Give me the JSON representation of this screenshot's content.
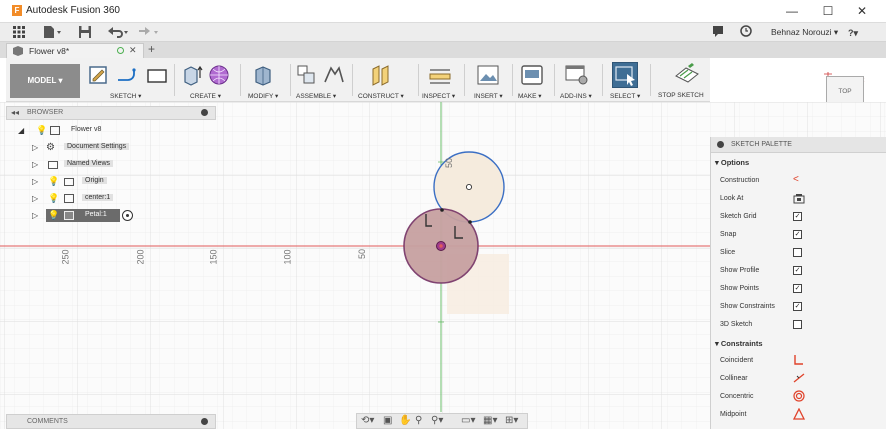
{
  "window": {
    "title": "Autodesk Fusion 360",
    "minimize": "—",
    "maximize": "☐",
    "close": "✕"
  },
  "quickbar": {
    "user_name": "Behnaz Norouzi ▾",
    "help": "?▾"
  },
  "tab": {
    "label": "Flower v8*",
    "close": "✕",
    "add": "+"
  },
  "toolbar": {
    "model_label": "MODEL ▾",
    "groups": {
      "sketch": "SKETCH ▾",
      "create": "CREATE ▾",
      "modify": "MODIFY ▾",
      "assemble": "ASSEMBLE ▾",
      "construct": "CONSTRUCT ▾",
      "inspect": "INSPECT ▾",
      "insert": "INSERT ▾",
      "make": "MAKE ▾",
      "addins": "ADD-INS ▾",
      "select": "SELECT ▾",
      "stop_sketch": "STOP SKETCH"
    }
  },
  "browser": {
    "header": "BROWSER",
    "root": "Flower v8",
    "items": [
      {
        "label": "Document Settings"
      },
      {
        "label": "Named Views"
      },
      {
        "label": "Origin"
      },
      {
        "label": "center:1"
      },
      {
        "label": "Petal:1"
      }
    ]
  },
  "comments": {
    "header": "COMMENTS"
  },
  "viewcube": {
    "label": "TOP"
  },
  "canvas": {
    "ruler_labels": [
      "250",
      "200",
      "150",
      "100",
      "50"
    ],
    "vertical_label": "50"
  },
  "palette": {
    "header": "SKETCH PALETTE",
    "options_title": "Options",
    "options": [
      {
        "label": "Construction",
        "type": "icon",
        "icon": "construction-icon"
      },
      {
        "label": "Look At",
        "type": "icon",
        "icon": "look-at-icon"
      },
      {
        "label": "Sketch Grid",
        "type": "check",
        "checked": true
      },
      {
        "label": "Snap",
        "type": "check",
        "checked": true
      },
      {
        "label": "Slice",
        "type": "check",
        "checked": false
      },
      {
        "label": "Show Profile",
        "type": "check",
        "checked": true
      },
      {
        "label": "Show Points",
        "type": "check",
        "checked": true
      },
      {
        "label": "Show Constraints",
        "type": "check",
        "checked": true
      },
      {
        "label": "3D Sketch",
        "type": "check",
        "checked": false
      }
    ],
    "constraints_title": "Constraints",
    "constraints": [
      {
        "label": "Coincident",
        "icon": "coincident-icon"
      },
      {
        "label": "Collinear",
        "icon": "collinear-icon"
      },
      {
        "label": "Concentric",
        "icon": "concentric-icon"
      },
      {
        "label": "Midpoint",
        "icon": "midpoint-icon"
      }
    ]
  },
  "colors": {
    "accent_blue": "#4a7fb5",
    "axis_red": "#d9534f",
    "axis_green": "#5cb85c",
    "profile_fill": "#f3e6d6"
  }
}
